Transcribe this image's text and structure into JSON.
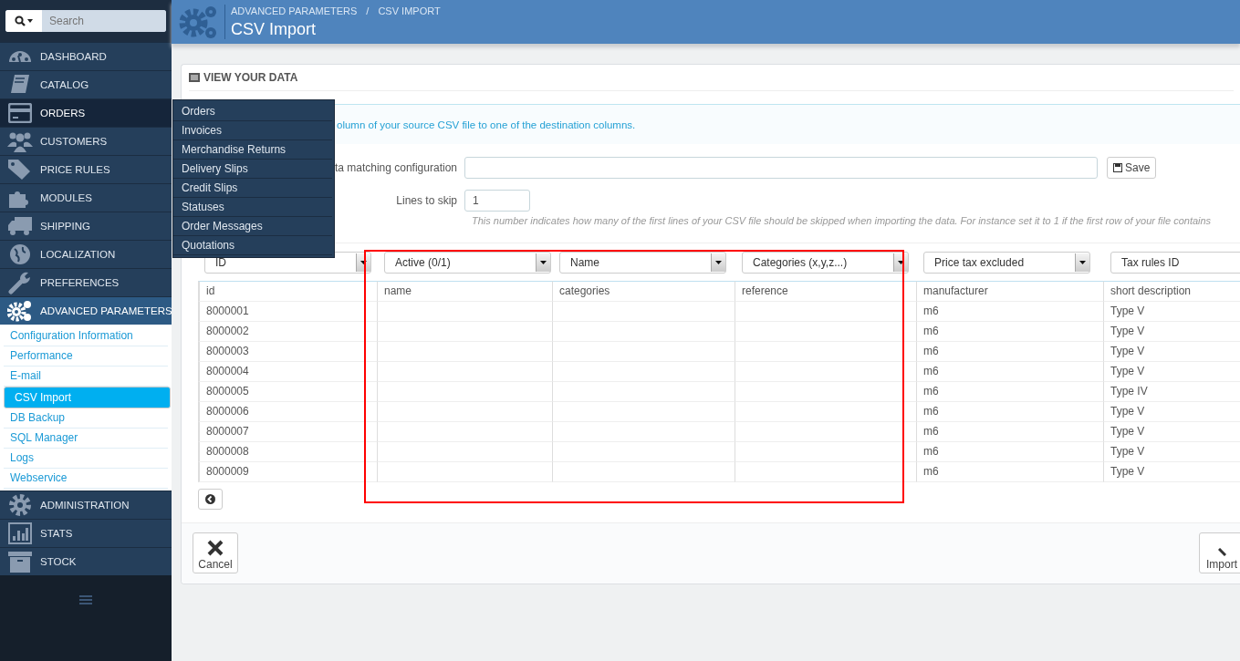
{
  "search": {
    "placeholder": "Search"
  },
  "sidebar": {
    "items": [
      {
        "label": "DASHBOARD",
        "hovered": false,
        "expanded": false
      },
      {
        "label": "CATALOG",
        "hovered": false,
        "expanded": false
      },
      {
        "label": "ORDERS",
        "hovered": true,
        "expanded": false
      },
      {
        "label": "CUSTOMERS",
        "hovered": false,
        "expanded": false
      },
      {
        "label": "PRICE RULES",
        "hovered": false,
        "expanded": false
      },
      {
        "label": "MODULES",
        "hovered": false,
        "expanded": false
      },
      {
        "label": "SHIPPING",
        "hovered": false,
        "expanded": false
      },
      {
        "label": "LOCALIZATION",
        "hovered": false,
        "expanded": false
      },
      {
        "label": "PREFERENCES",
        "hovered": false,
        "expanded": false
      },
      {
        "label": "ADVANCED PARAMETERS",
        "hovered": false,
        "expanded": true,
        "children": [
          {
            "label": "Configuration Information",
            "selected": false
          },
          {
            "label": "Performance",
            "selected": false
          },
          {
            "label": "E-mail",
            "selected": false
          },
          {
            "label": "CSV Import",
            "selected": true
          },
          {
            "label": "DB Backup",
            "selected": false
          },
          {
            "label": "SQL Manager",
            "selected": false
          },
          {
            "label": "Logs",
            "selected": false
          },
          {
            "label": "Webservice",
            "selected": false
          }
        ]
      },
      {
        "label": "ADMINISTRATION",
        "hovered": false,
        "expanded": false
      },
      {
        "label": "STATS",
        "hovered": false,
        "expanded": false
      },
      {
        "label": "STOCK",
        "hovered": false,
        "expanded": false
      }
    ]
  },
  "flyout_menu": [
    "Orders",
    "Invoices",
    "Merchandise Returns",
    "Delivery Slips",
    "Credit Slips",
    "Statuses",
    "Order Messages",
    "Quotations"
  ],
  "header": {
    "breadcrumb": [
      "ADVANCED PARAMETERS",
      "CSV IMPORT"
    ],
    "breadcrumb_separator": "/",
    "title": "CSV Import"
  },
  "panel": {
    "heading": "VIEW YOUR DATA",
    "info": "olumn of your source CSV file to one of the destination columns.",
    "fields": [
      {
        "label": "ta matching configuration",
        "button": "Save"
      },
      {
        "label": "Lines to skip",
        "value": "1",
        "help": "This number indicates how many of the first lines of your CSV file should be skipped when importing the data. For instance set it to 1 if the first row of your file contains"
      }
    ],
    "column_selects": [
      "ID",
      "Active (0/1)",
      "Name",
      "Categories (x,y,z...)",
      "Price tax excluded",
      "Tax rules ID"
    ],
    "table": {
      "columns": [
        "id",
        "name",
        "categories",
        "reference",
        "manufacturer",
        "short description"
      ],
      "rows": [
        [
          "8000001",
          null,
          null,
          null,
          "m6",
          "Type V"
        ],
        [
          "8000002",
          null,
          null,
          null,
          "m6",
          "Type V"
        ],
        [
          "8000003",
          null,
          null,
          null,
          "m6",
          "Type V"
        ],
        [
          "8000004",
          null,
          null,
          null,
          "m6",
          "Type V"
        ],
        [
          "8000005",
          null,
          null,
          null,
          "m6",
          "Type IV"
        ],
        [
          "8000006",
          null,
          null,
          null,
          "m6",
          "Type V"
        ],
        [
          "8000007",
          null,
          null,
          null,
          "m6",
          "Type V"
        ],
        [
          "8000008",
          null,
          null,
          null,
          "m6",
          "Type V"
        ],
        [
          "8000009",
          null,
          null,
          null,
          "m6",
          "Type V"
        ]
      ]
    },
    "footer": {
      "cancel": "Cancel",
      "import": "Import"
    }
  }
}
